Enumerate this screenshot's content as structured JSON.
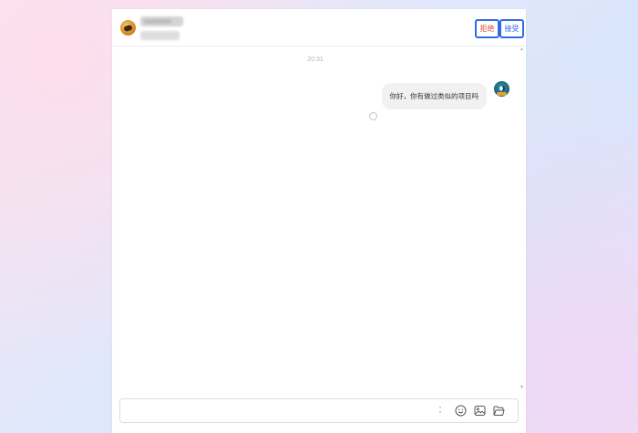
{
  "header": {
    "reject_label": "拒绝",
    "accept_label": "接受"
  },
  "messages": {
    "timestamp": "20:31",
    "items": [
      {
        "from": "self",
        "text": "你好，你有做过类似的项目吗"
      }
    ]
  },
  "composer": {
    "value": "",
    "placeholder": "",
    "tools": [
      "emoji-icon",
      "image-icon",
      "folder-icon"
    ]
  },
  "colors": {
    "accent": "#2f6be8",
    "reject": "#e04b3b",
    "bubble": "#f1f1f1"
  }
}
